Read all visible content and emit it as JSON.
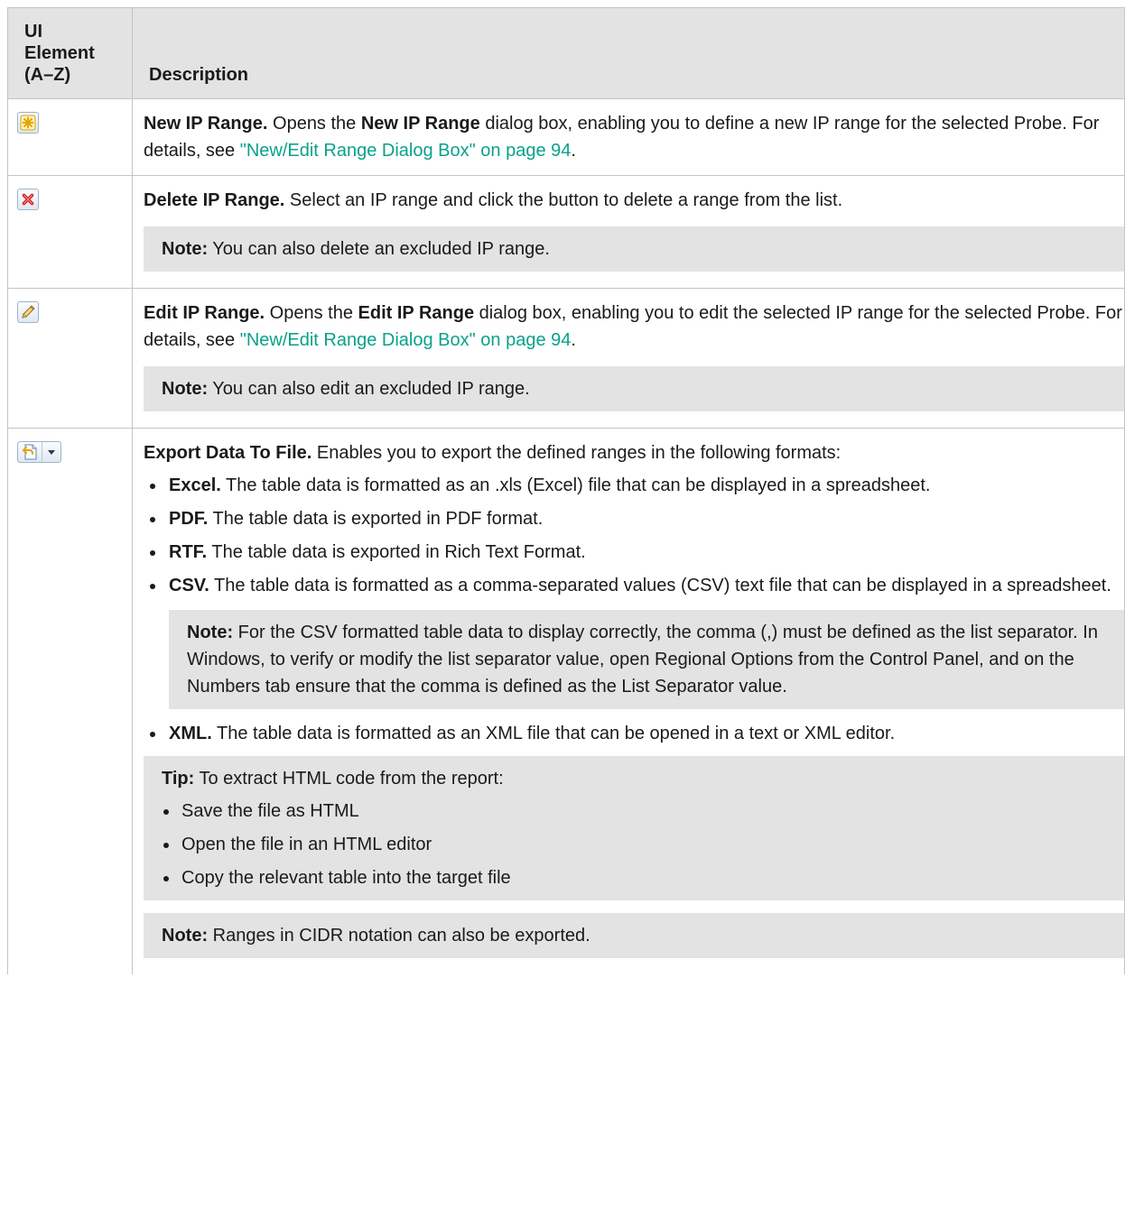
{
  "table": {
    "header": {
      "ui_element": "UI Element (A–Z)",
      "description": "Description"
    },
    "rows": [
      {
        "icon": "new-range-icon",
        "title": "New IP Range.",
        "text_before": " Opens the ",
        "bold_term": "New IP Range",
        "text_after": " dialog box, enabling you to define a new IP range for the selected Probe. For details, see ",
        "link": "\"New/Edit Range Dialog Box\" on page 94",
        "end": "."
      },
      {
        "icon": "delete-range-icon",
        "title": "Delete IP Range.",
        "text": " Select an IP range and click the button to delete a range from the list.",
        "note_label": "Note:",
        "note_text": " You can also delete an excluded IP range."
      },
      {
        "icon": "edit-range-icon",
        "title": "Edit IP Range.",
        "text_before": " Opens the ",
        "bold_term": "Edit IP Range",
        "text_after": " dialog box, enabling you to edit the selected IP range for the selected Probe. For details, see ",
        "link": "\"New/Edit Range Dialog Box\" on page 94",
        "end": ".",
        "note_label": "Note:",
        "note_text": " You can also edit an excluded IP range."
      },
      {
        "icon": "export-data-icon",
        "title": "Export Data To File.",
        "text": " Enables you to export the defined ranges in the following formats:",
        "formats": [
          {
            "name": "Excel.",
            "text": " The table data is formatted as an .xls (Excel) file that can be displayed in a spreadsheet."
          },
          {
            "name": "PDF.",
            "text": " The table data is exported in PDF format."
          },
          {
            "name": "RTF.",
            "text": " The table data is exported in Rich Text Format."
          },
          {
            "name": "CSV.",
            "text": " The table data is formatted as a comma-separated values (CSV) text file that can be displayed in a spreadsheet."
          }
        ],
        "csv_note_label": "Note:",
        "csv_note_text": " For the CSV formatted table data to display correctly, the comma (,) must be defined as the list separator. In Windows, to verify or modify the list separator value, open Regional Options from the Control Panel, and on the Numbers tab ensure that the comma is defined as the List Separator value.",
        "xml": {
          "name": "XML.",
          "text": " The table data is formatted as an XML file that can be opened in a text or XML editor."
        },
        "tip_label": "Tip:",
        "tip_text": " To extract HTML code from the report:",
        "tip_steps": [
          "Save the file as HTML",
          "Open the file in an HTML editor",
          "Copy the relevant table into the target file"
        ],
        "cidr_note_label": "Note:",
        "cidr_note_text": " Ranges in CIDR notation can also be exported."
      }
    ]
  }
}
